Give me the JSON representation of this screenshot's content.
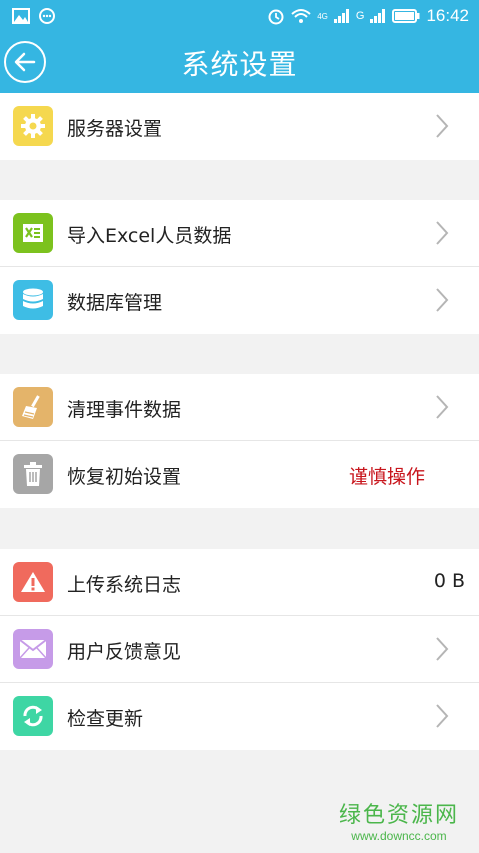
{
  "status_bar": {
    "time": "16:42",
    "network_4g": "4G",
    "network_g": "G"
  },
  "header": {
    "title": "系统设置"
  },
  "colors": {
    "header": "#35b6e2",
    "server_icon": "#f5d84f",
    "excel_icon": "#7cc21e",
    "db_icon": "#3ebde5",
    "clean_icon": "#e4b46a",
    "restore_icon": "#a6a6a6",
    "upload_icon": "#f06a5d",
    "feedback_icon": "#c69be8",
    "update_icon": "#3ed6a4",
    "warning_text": "#c8161d"
  },
  "groups": [
    {
      "items": [
        {
          "label": "服务器设置",
          "icon": "gear-icon"
        }
      ]
    },
    {
      "items": [
        {
          "label": "导入Excel人员数据",
          "icon": "excel-icon"
        },
        {
          "label": "数据库管理",
          "icon": "database-icon"
        }
      ]
    },
    {
      "items": [
        {
          "label": "清理事件数据",
          "icon": "broom-icon"
        },
        {
          "label": "恢复初始设置",
          "icon": "trash-icon",
          "note": "谨慎操作"
        }
      ]
    },
    {
      "items": [
        {
          "label": "上传系统日志",
          "icon": "warning-icon",
          "value": "0 B"
        },
        {
          "label": "用户反馈意见",
          "icon": "mail-icon"
        },
        {
          "label": "检查更新",
          "icon": "refresh-icon"
        }
      ]
    }
  ],
  "watermark": {
    "main": "绿色资源网",
    "sub": "www.downcc.com"
  }
}
